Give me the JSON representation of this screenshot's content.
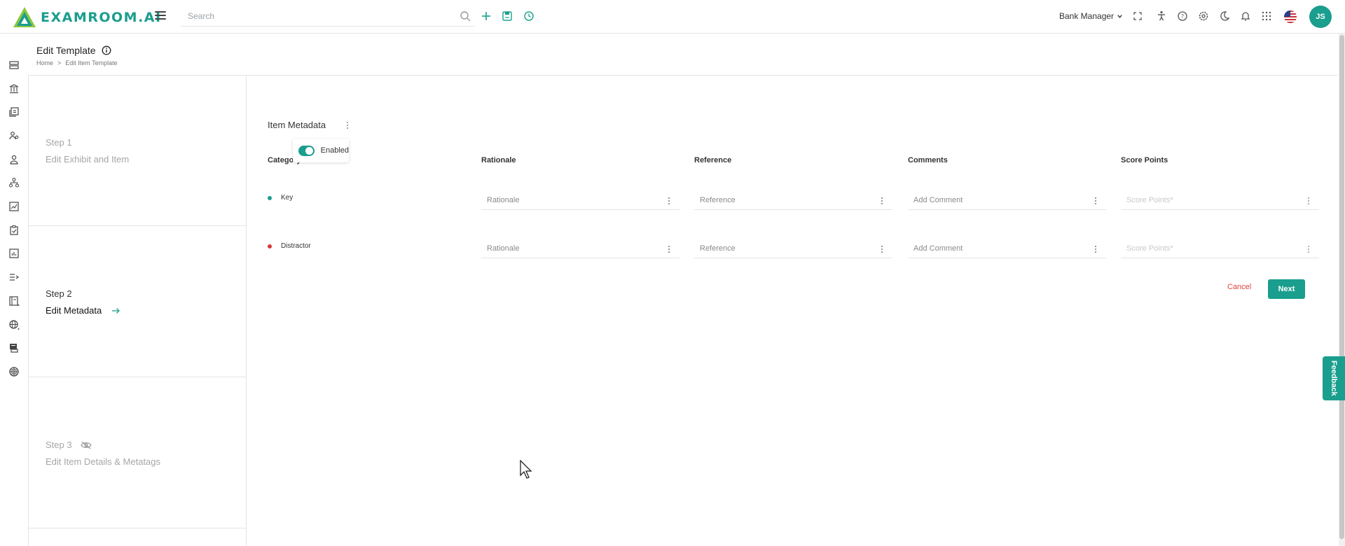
{
  "app": {
    "logo_text": "EXAMROOM.AI",
    "brand_color": "#1a9e8e"
  },
  "topbar": {
    "search_placeholder": "Search",
    "role": "Bank Manager",
    "avatar_initials": "JS",
    "icons": [
      "search-icon",
      "plus-icon",
      "save-icon",
      "history-icon",
      "fullscreen-icon",
      "accessibility-icon",
      "help-icon",
      "settings-icon",
      "dark-mode-icon",
      "bell-icon",
      "apps-grid-icon",
      "us-flag-icon"
    ]
  },
  "sidebar": {
    "icons": [
      "dashboard-icon",
      "bank-icon",
      "items-icon",
      "users-icon",
      "person-icon",
      "hierarchy-icon",
      "reports-icon",
      "tasks-icon",
      "analytics-icon",
      "list-icon",
      "book-icon",
      "globe-icon",
      "print-icon",
      "web-icon"
    ]
  },
  "page": {
    "title": "Edit Template",
    "breadcrumb": [
      "Home",
      "Edit Item Template"
    ]
  },
  "steps": [
    {
      "number": "Step 1",
      "label": "Edit Exhibit and Item"
    },
    {
      "number": "Step 2",
      "label": "Edit Metadata"
    },
    {
      "number": "Step 3",
      "label": "Edit Item Details & Metatags"
    }
  ],
  "main": {
    "section_title": "Item Metadata",
    "toggle_label": "Enabled",
    "toggle_on": true,
    "columns": [
      "Category",
      "Rationale",
      "Reference",
      "Comments",
      "Score Points"
    ],
    "rows": [
      {
        "category": "Key",
        "dot_color": "#1a9e8e",
        "rationale": "Rationale",
        "reference": "Reference",
        "comment": "Add Comment",
        "score": "Score Points*"
      },
      {
        "category": "Distractor",
        "dot_color": "#d33a3a",
        "rationale": "Rationale",
        "reference": "Reference",
        "comment": "Add Comment",
        "score": "Score Points*"
      }
    ],
    "cancel_label": "Cancel",
    "next_label": "Next"
  },
  "feedback_label": "Feedback"
}
